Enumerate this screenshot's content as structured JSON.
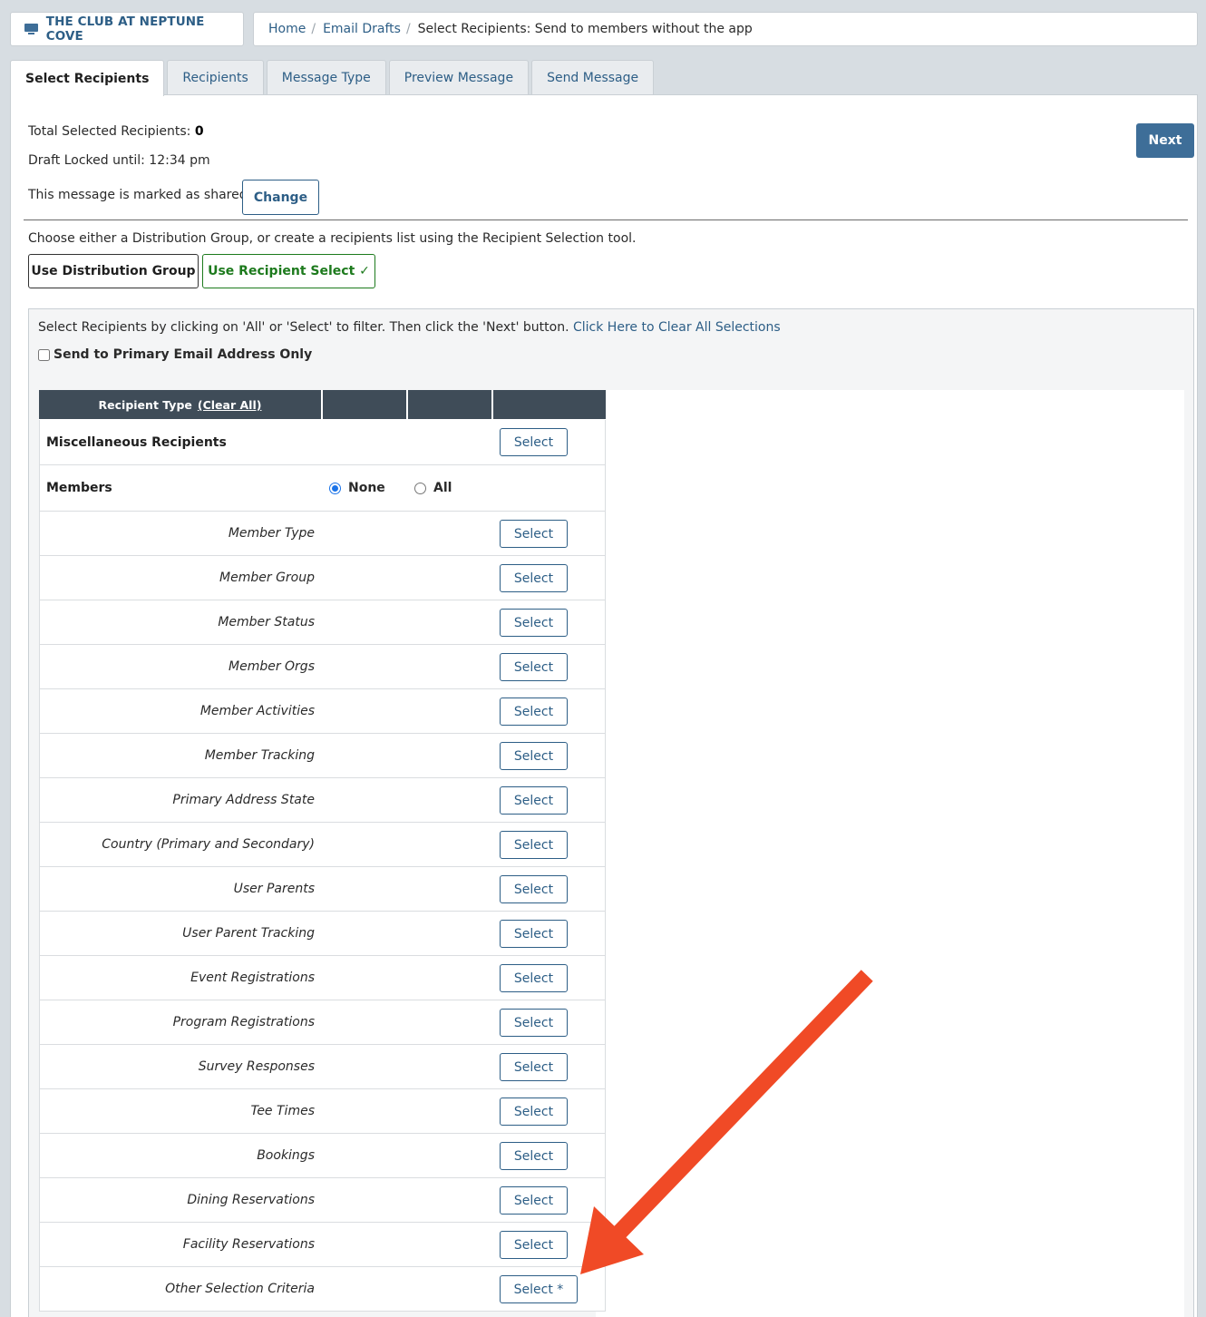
{
  "brand": {
    "name": "THE CLUB AT NEPTUNE COVE"
  },
  "breadcrumb": {
    "home": "Home",
    "drafts": "Email Drafts",
    "current": "Select Recipients: Send to members without the app"
  },
  "tabs": [
    "Select Recipients",
    "Recipients",
    "Message Type",
    "Preview Message",
    "Send Message"
  ],
  "summary": {
    "total_label": "Total Selected Recipients: ",
    "total_value": "0",
    "locked": "Draft Locked until: 12:34 pm",
    "shared": "This message is marked as shared.",
    "change_label": "Change",
    "next_label": "Next"
  },
  "choose": {
    "text": "Choose either a Distribution Group, or create a recipients list using the Recipient Selection tool.",
    "distribution_label": "Use Distribution Group",
    "recipient_label": "Use Recipient Select ✓"
  },
  "selection": {
    "instructions": "Select Recipients by clicking on 'All' or 'Select' to filter. Then click the 'Next' button.",
    "clear_all_link": "Click Here to Clear All Selections",
    "primary_only": "Send to Primary Email Address Only"
  },
  "table": {
    "header": "Recipient Type",
    "header_clear": "(Clear All)",
    "misc_label": "Miscellaneous Recipients",
    "members_label": "Members",
    "radio_none": "None",
    "radio_all": "All",
    "radio_selected": "None",
    "select_label": "Select",
    "select_star_label": "Select *",
    "criteria": [
      "Member Type",
      "Member Group",
      "Member Status",
      "Member Orgs",
      "Member Activities",
      "Member Tracking",
      "Primary Address State",
      "Country (Primary and Secondary)",
      "User Parents",
      "User Parent Tracking",
      "Event Registrations",
      "Program Registrations",
      "Survey Responses",
      "Tee Times",
      "Bookings",
      "Dining Reservations",
      "Facility Reservations",
      "Other Selection Criteria"
    ]
  },
  "colors": {
    "accent": "#3e6e98",
    "link": "#2d5e86",
    "success": "#1d7a1d",
    "header": "#3f4c58",
    "annotation_arrow": "#f04a26"
  },
  "icons": {
    "brand": "monitor-icon",
    "recipient_check": "checkmark-icon"
  }
}
